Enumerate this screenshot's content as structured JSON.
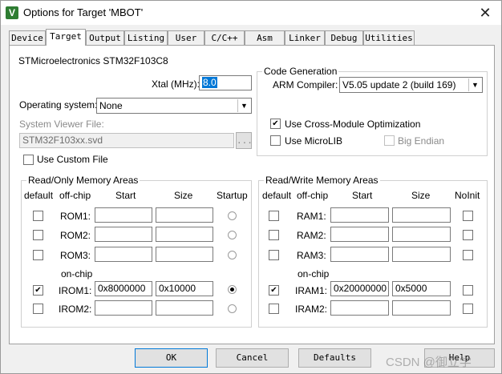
{
  "window": {
    "title": "Options for Target 'MBOT'",
    "close": "✕",
    "icon_letter": "V"
  },
  "tabs": [
    "Device",
    "Target",
    "Output",
    "Listing",
    "User",
    "C/C++",
    "Asm",
    "Linker",
    "Debug",
    "Utilities"
  ],
  "target": {
    "device_name": "STMicroelectronics STM32F103C8",
    "xtal_label": "Xtal (MHz):",
    "xtal_value": "8.0",
    "os_label": "Operating system:",
    "os_value": "None",
    "sv_label": "System Viewer File:",
    "sv_value": "STM32F103xx.svd",
    "browse": "...",
    "custom_file": "Use Custom File"
  },
  "codegen": {
    "legend": "Code Generation",
    "compiler_label": "ARM Compiler:",
    "compiler_value": "V5.05 update 2 (build 169)",
    "cross_module": "Use Cross-Module Optimization",
    "microlib": "Use MicroLIB",
    "big_endian": "Big Endian"
  },
  "ro": {
    "legend": "Read/Only Memory Areas",
    "headers": {
      "default": "default",
      "offchip": "off-chip",
      "start": "Start",
      "size": "Size",
      "startup": "Startup"
    },
    "onchip": "on-chip",
    "rows": [
      {
        "label": "ROM1:",
        "start": "",
        "size": ""
      },
      {
        "label": "ROM2:",
        "start": "",
        "size": ""
      },
      {
        "label": "ROM3:",
        "start": "",
        "size": ""
      },
      {
        "label": "IROM1:",
        "start": "0x8000000",
        "size": "0x10000"
      },
      {
        "label": "IROM2:",
        "start": "",
        "size": ""
      }
    ]
  },
  "rw": {
    "legend": "Read/Write Memory Areas",
    "headers": {
      "default": "default",
      "offchip": "off-chip",
      "start": "Start",
      "size": "Size",
      "noinit": "NoInit"
    },
    "onchip": "on-chip",
    "rows": [
      {
        "label": "RAM1:",
        "start": "",
        "size": ""
      },
      {
        "label": "RAM2:",
        "start": "",
        "size": ""
      },
      {
        "label": "RAM3:",
        "start": "",
        "size": ""
      },
      {
        "label": "IRAM1:",
        "start": "0x20000000",
        "size": "0x5000"
      },
      {
        "label": "IRAM2:",
        "start": "",
        "size": ""
      }
    ]
  },
  "buttons": {
    "ok": "OK",
    "cancel": "Cancel",
    "defaults": "Defaults",
    "help": "Help"
  },
  "watermark": "CSDN @御立学"
}
